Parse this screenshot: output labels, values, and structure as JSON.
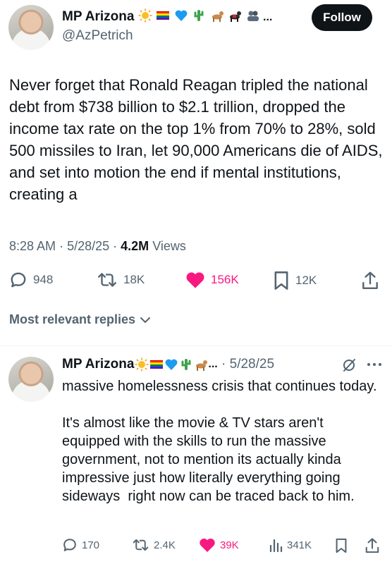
{
  "tweet": {
    "author_name": "MP Arizona",
    "author_handle": "@AzPetrich",
    "name_emojis": [
      "sun-emoji",
      "rainbow-flag-emoji",
      "blue-heart-emoji",
      "cactus-emoji",
      "dog-emoji",
      "service-dog-emoji",
      "group-emoji"
    ],
    "ellipsis": "...",
    "follow_label": "Follow",
    "text": "Never forget that Ronald Reagan tripled the national debt from $738 billion to $2.1 trillion, dropped the income tax rate on the top 1% from 70% to 28%, sold 500 missiles to Iran, let 90,000 Americans die of AIDS, and set into motion the end if mental institutions, creating a",
    "time": "8:28 AM",
    "date": "5/28/25",
    "views_count": "4.2M",
    "views_label": "Views",
    "replies": "948",
    "reposts": "18K",
    "likes": "156K",
    "bookmarks": "12K"
  },
  "replies_header": "Most relevant replies",
  "reply": {
    "author_name": "MP Arizona",
    "name_emojis": [
      "sun-emoji",
      "rainbow-flag-emoji",
      "blue-heart-emoji",
      "cactus-emoji",
      "dog-emoji"
    ],
    "ellipsis": "...",
    "date": "5/28/25",
    "text": "massive homelessness crisis that continues today.\n\nIt's almost like the movie & TV stars aren't equipped with the skills to run the massive government, not to mention its actually kinda impressive just how literally everything going sideways  right now can be traced back to him.",
    "replies": "170",
    "reposts": "2.4K",
    "likes": "39K",
    "views": "341K"
  },
  "colors": {
    "text": "#0f1419",
    "secondary": "#536471",
    "like": "#f91880",
    "follow_bg": "#0f1419"
  }
}
